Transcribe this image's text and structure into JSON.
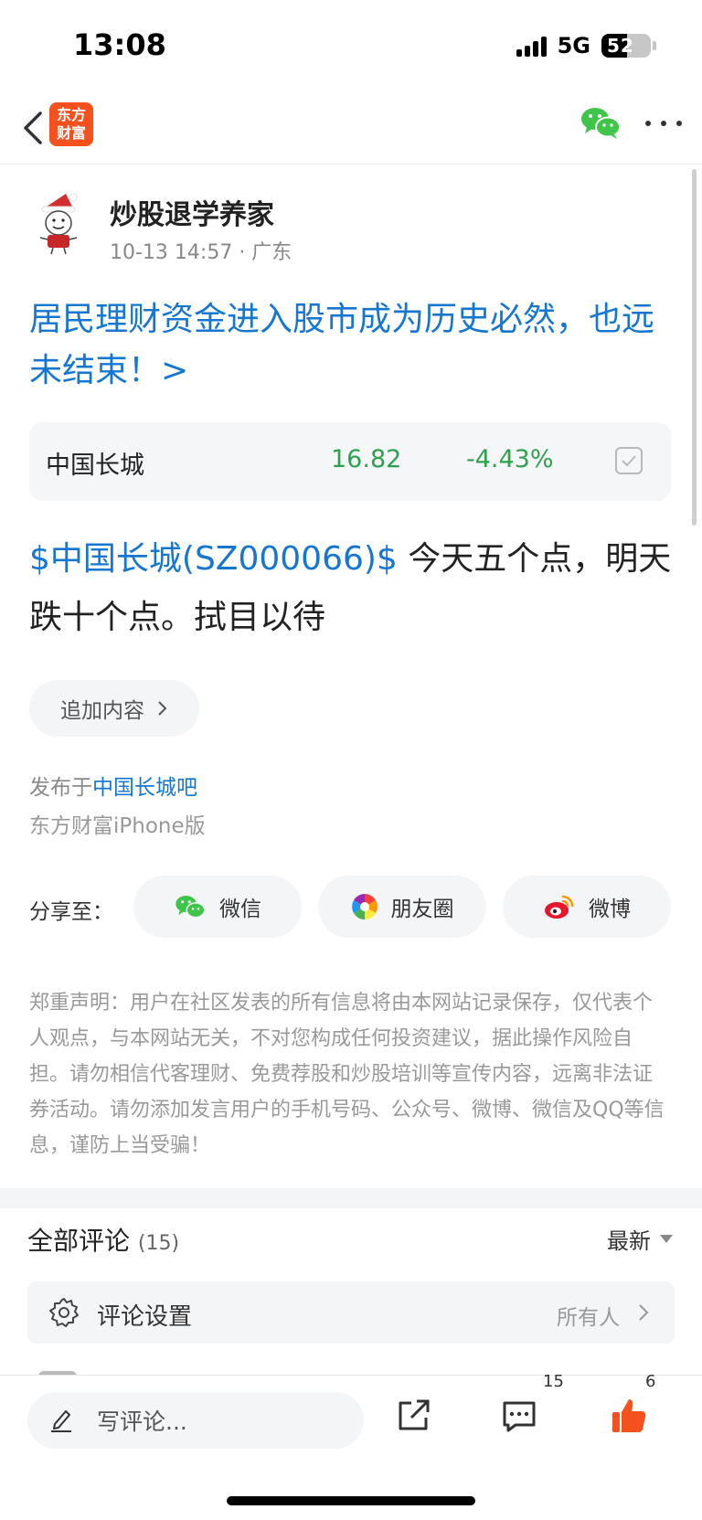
{
  "status_bar": {
    "time": "13:08",
    "network": "5G",
    "battery": "52",
    "battery_level": 0.52
  },
  "nav": {
    "logo_line1": "东方",
    "logo_line2": "财富"
  },
  "post": {
    "author_name": "炒股退学养家",
    "meta": "10-13 14:57 · 广东",
    "title": "居民理财资金进入股市成为历史必然，也远未结束！>",
    "stock": {
      "name": "中国长城",
      "price": "16.82",
      "change": "-4.43%"
    },
    "content_tag": "$中国长城(SZ000066)$",
    "content_text": " 今天五个点，明天跌十个点。拭目以待",
    "append_label": "追加内容",
    "posted_prefix": "发布于",
    "posted_bar": "中国长城吧",
    "source": "东方财富iPhone版",
    "share_label": "分享至：",
    "share_wechat": "微信",
    "share_moments": "朋友圈",
    "share_weibo": "微博",
    "disclaimer": "郑重声明：用户在社区发表的所有信息将由本网站记录保存，仅代表个人观点，与本网站无关，不对您构成任何投资建议，据此操作风险自担。请勿相信代客理财、免费荐股和炒股培训等宣传内容，远离非法证券活动。请勿添加发言用户的手机号码、公众号、微博、微信及QQ等信息，谨防上当受骗！"
  },
  "comments": {
    "heading": "全部评论",
    "count": "(15)",
    "sort_label": "最新",
    "settings_label": "评论设置",
    "settings_value": "所有人"
  },
  "bottom_bar": {
    "input_placeholder": "写评论...",
    "comment_count": "15",
    "like_count": "6"
  },
  "colors": {
    "accent_blue": "#1677d2",
    "down_green": "#2da24c",
    "like_orange": "#f4511e",
    "wechat_green": "#3fc64a"
  }
}
